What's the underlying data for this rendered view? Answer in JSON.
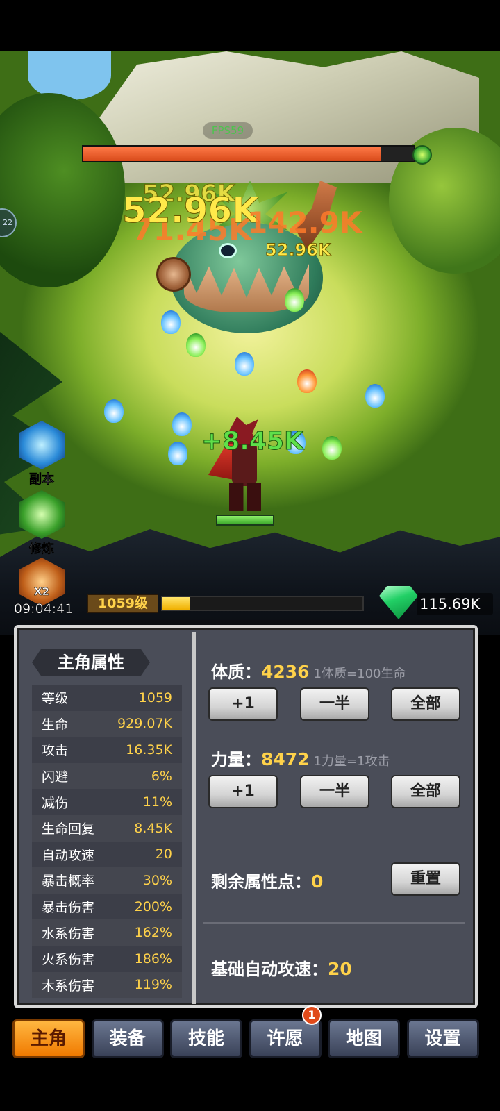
{
  "hud": {
    "fps_label": "FPS59",
    "boss_hp_fraction": 0.9,
    "hero_hp_fraction": 1.0,
    "xp_fraction": 0.14,
    "edge_label": "22"
  },
  "damage_numbers": [
    {
      "text": "52.96K",
      "style": "yellow"
    },
    {
      "text": "52.96K",
      "style": "yellow"
    },
    {
      "text": "71.45K",
      "style": "orange"
    },
    {
      "text": "142.9K",
      "style": "orange"
    },
    {
      "text": "52.96K",
      "style": "yellow"
    },
    {
      "text": "+8.45K",
      "style": "green"
    }
  ],
  "side_buttons": {
    "dungeon_label": "副本",
    "train_label": "修炼",
    "x2_label": "X2",
    "timer": "09:04:41"
  },
  "status": {
    "level": "1059级",
    "gems": "115.69K"
  },
  "attributes": {
    "title": "主角属性",
    "rows": [
      {
        "k": "等级",
        "v": "1059"
      },
      {
        "k": "生命",
        "v": "929.07K"
      },
      {
        "k": "攻击",
        "v": "16.35K"
      },
      {
        "k": "闪避",
        "v": "6%"
      },
      {
        "k": "减伤",
        "v": "11%"
      },
      {
        "k": "生命回复",
        "v": "8.45K"
      },
      {
        "k": "自动攻速",
        "v": "20"
      },
      {
        "k": "暴击概率",
        "v": "30%"
      },
      {
        "k": "暴击伤害",
        "v": "200%"
      },
      {
        "k": "水系伤害",
        "v": "162%"
      },
      {
        "k": "火系伤害",
        "v": "186%"
      },
      {
        "k": "木系伤害",
        "v": "119%"
      }
    ]
  },
  "allocation": {
    "con_label": "体质：",
    "con_value": "4236",
    "con_hint": "1体质=100生命",
    "str_label": "力量：",
    "str_value": "8472",
    "str_hint": "1力量=1攻击",
    "btn_plus1": "+1",
    "btn_half": "一半",
    "btn_all": "全部",
    "remaining_label": "剩余属性点：",
    "remaining_value": "0",
    "reset_label": "重置",
    "base_speed_label": "基础自动攻速：",
    "base_speed_value": "20"
  },
  "tabs": [
    {
      "label": "主角",
      "active": true
    },
    {
      "label": "装备"
    },
    {
      "label": "技能"
    },
    {
      "label": "许愿"
    },
    {
      "label": "地图"
    },
    {
      "label": "设置"
    }
  ],
  "wish_badge": "1",
  "colors": {
    "accent_gold": "#ffd24a",
    "tab_active": "#f59a1a",
    "hp_red": "#e8562a",
    "gem_green": "#22d066"
  }
}
